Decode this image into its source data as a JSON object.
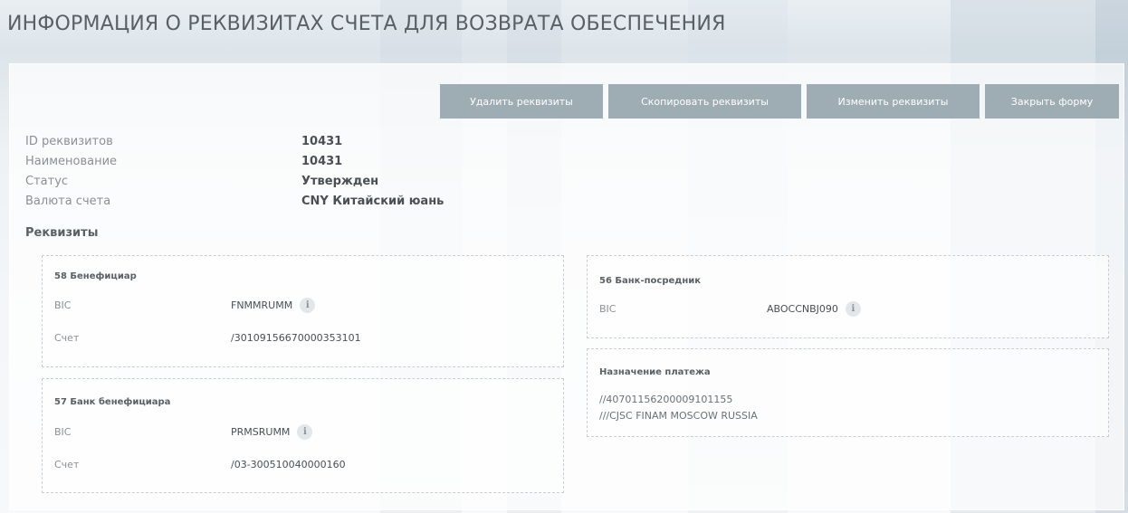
{
  "page": {
    "title": "ИНФОРМАЦИЯ О РЕКВИЗИТАХ СЧЕТА ДЛЯ ВОЗВРАТА ОБЕСПЕЧЕНИЯ"
  },
  "toolbar": {
    "delete_label": "Удалить реквизиты",
    "copy_label": "Скопировать реквизиты",
    "edit_label": "Изменить реквизиты",
    "close_label": "Закрыть форму"
  },
  "info": {
    "rows": [
      {
        "label": "ID реквизитов",
        "value": "10431"
      },
      {
        "label": "Наименование",
        "value": "10431"
      },
      {
        "label": "Статус",
        "value": "Утвержден"
      },
      {
        "label": "Валюта счета",
        "value": "CNY Китайский юань"
      }
    ],
    "section_title": "Реквизиты"
  },
  "beneficiary": {
    "title": "58 Бенефициар",
    "bic_label": "BIC",
    "bic_value": "FNMMRUMM",
    "account_label": "Счет",
    "account_value": "/30109156670000353101"
  },
  "beneficiary_bank": {
    "title": "57 Банк бенефициара",
    "bic_label": "BIC",
    "bic_value": "PRMSRUMM",
    "account_label": "Счет",
    "account_value": "/03-300510040000160"
  },
  "intermediary_bank": {
    "title": "56 Банк-посредник",
    "bic_label": "BIC",
    "bic_value": "ABOCCNBJ090"
  },
  "payment_purpose": {
    "title": "Назначение платежа",
    "line1": "//40701156200009101155",
    "line2": "///CJSC FINAM MOSCOW RUSSIA"
  },
  "icons": {
    "info_glyph": "i"
  },
  "colors": {
    "button_bg": "#9eacb4",
    "title_text": "#5a5f66"
  }
}
